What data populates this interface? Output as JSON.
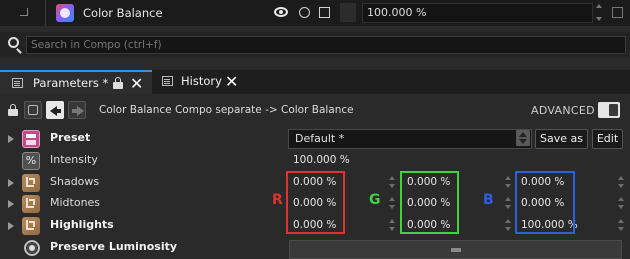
{
  "layer": {
    "title": "Color Balance",
    "opacity": "100.000 %"
  },
  "search": {
    "placeholder": "Search in Compo (ctrl+f)"
  },
  "tabs": [
    {
      "label": "Parameters *"
    },
    {
      "label": "History"
    }
  ],
  "toolbar": {
    "breadcrumb": "Color Balance Compo separate -> Color Balance",
    "advanced_label": "ADVANCED"
  },
  "params": {
    "preset": {
      "label": "Preset",
      "value": "Default *",
      "save_as": "Save as",
      "edit": "Edit"
    },
    "intensity": {
      "label": "Intensity",
      "value": "100.000 %"
    },
    "shadows": {
      "label": "Shadows",
      "r": "0.000 %",
      "g": "0.000 %",
      "b": "0.000 %"
    },
    "midtones": {
      "label": "Midtones",
      "r": "0.000 %",
      "g": "0.000 %",
      "b": "0.000 %"
    },
    "highlights": {
      "label": "Highlights",
      "r": "0.000 %",
      "g": "0.000 %",
      "b": "100.000 %"
    },
    "preserve_luminosity": {
      "label": "Preserve Luminosity"
    }
  },
  "channels": {
    "r": {
      "label": "R",
      "color": "#e23232"
    },
    "g": {
      "label": "G",
      "color": "#3ed43e"
    },
    "b": {
      "label": "B",
      "color": "#2d5fe0"
    }
  },
  "colors": {
    "accent_tab": "#3c8fd8",
    "background": "#2a2a2a"
  }
}
